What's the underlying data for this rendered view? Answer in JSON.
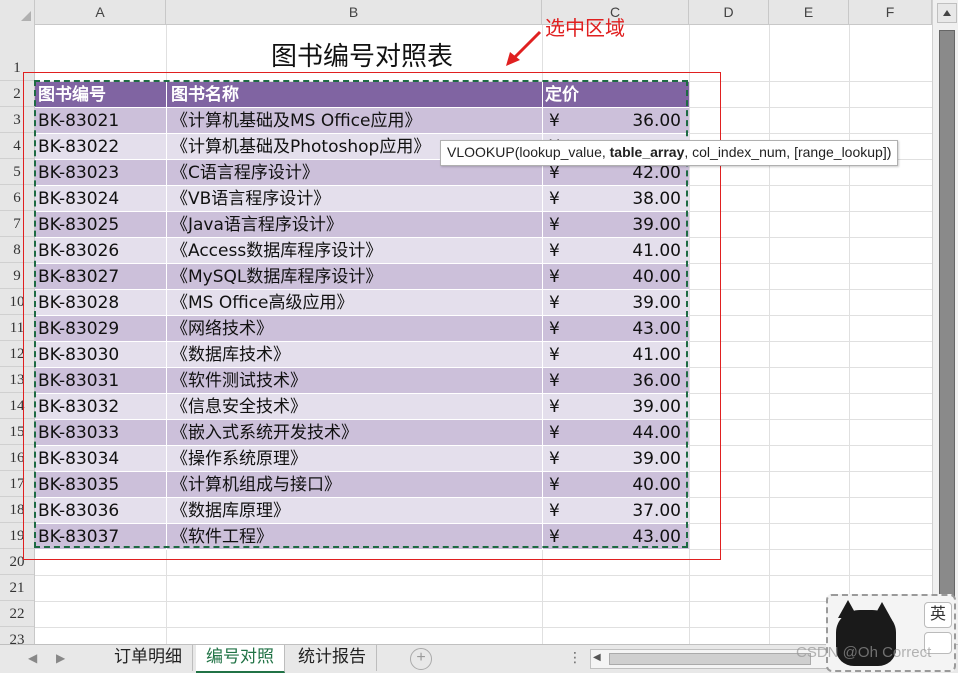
{
  "sheet": {
    "columns": [
      "A",
      "B",
      "C",
      "D",
      "E",
      "F"
    ],
    "rows": [
      "1",
      "2",
      "3",
      "4",
      "5",
      "6",
      "7",
      "8",
      "9",
      "10",
      "11",
      "12",
      "13",
      "14",
      "15",
      "16",
      "17",
      "18",
      "19",
      "20",
      "21",
      "22",
      "23"
    ],
    "title": "图书编号对照表",
    "headers": {
      "code": "图书编号",
      "name": "图书名称",
      "price": "定价"
    },
    "currency": "¥",
    "books": [
      {
        "code": "BK-83021",
        "name": "《计算机基础及MS Office应用》",
        "price": "36.00"
      },
      {
        "code": "BK-83022",
        "name": "《计算机基础及Photoshop应用》",
        "price": ""
      },
      {
        "code": "BK-83023",
        "name": "《C语言程序设计》",
        "price": "42.00"
      },
      {
        "code": "BK-83024",
        "name": "《VB语言程序设计》",
        "price": "38.00"
      },
      {
        "code": "BK-83025",
        "name": "《Java语言程序设计》",
        "price": "39.00"
      },
      {
        "code": "BK-83026",
        "name": "《Access数据库程序设计》",
        "price": "41.00"
      },
      {
        "code": "BK-83027",
        "name": "《MySQL数据库程序设计》",
        "price": "40.00"
      },
      {
        "code": "BK-83028",
        "name": "《MS Office高级应用》",
        "price": "39.00"
      },
      {
        "code": "BK-83029",
        "name": "《网络技术》",
        "price": "43.00"
      },
      {
        "code": "BK-83030",
        "name": "《数据库技术》",
        "price": "41.00"
      },
      {
        "code": "BK-83031",
        "name": "《软件测试技术》",
        "price": "36.00"
      },
      {
        "code": "BK-83032",
        "name": "《信息安全技术》",
        "price": "39.00"
      },
      {
        "code": "BK-83033",
        "name": "《嵌入式系统开发技术》",
        "price": "44.00"
      },
      {
        "code": "BK-83034",
        "name": "《操作系统原理》",
        "price": "39.00"
      },
      {
        "code": "BK-83035",
        "name": "《计算机组成与接口》",
        "price": "40.00"
      },
      {
        "code": "BK-83036",
        "name": "《数据库原理》",
        "price": "37.00"
      },
      {
        "code": "BK-83037",
        "name": "《软件工程》",
        "price": "43.00"
      }
    ]
  },
  "annotation": {
    "label": "选中区域",
    "color": "#e02020"
  },
  "tooltip": {
    "prefix": "VLOOKUP(lookup_value, ",
    "bold": "table_array",
    "suffix": ", col_index_num, [range_lookup])"
  },
  "tabs": [
    {
      "label": "订单明细",
      "active": false
    },
    {
      "label": "编号对照",
      "active": true
    },
    {
      "label": "统计报告",
      "active": false
    }
  ],
  "ime": {
    "label": "英"
  },
  "watermark": "CSDN @Oh Correct",
  "colors": {
    "header": "#8064a2",
    "row_odd": "#ccc0da",
    "row_even": "#e4dfec",
    "active_tab": "#217346",
    "selection": "#1e6b43"
  },
  "icons": {
    "add_sheet": "plus-circle-icon",
    "nav_prev": "triangle-left-icon",
    "nav_next": "triangle-right-icon"
  }
}
